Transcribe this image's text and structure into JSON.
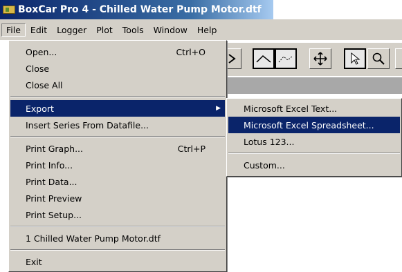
{
  "window": {
    "title": "BoxCar Pro 4 - Chilled Water Pump Motor.dtf"
  },
  "menubar": [
    "File",
    "Edit",
    "Logger",
    "Plot",
    "Tools",
    "Window",
    "Help"
  ],
  "file_menu": {
    "open": {
      "label": "Open...",
      "shortcut": "Ctrl+O"
    },
    "close": "Close",
    "close_all": "Close All",
    "export": "Export",
    "insert_series": "Insert Series From Datafile...",
    "print_graph": {
      "label": "Print Graph...",
      "shortcut": "Ctrl+P"
    },
    "print_info": "Print Info...",
    "print_data": "Print Data...",
    "print_preview": "Print Preview",
    "print_setup": "Print Setup...",
    "recent_file": "1 Chilled Water Pump Motor.dtf",
    "exit": "Exit"
  },
  "export_menu": {
    "excel_text": "Microsoft Excel Text...",
    "excel_spreadsheet": "Microsoft Excel Spreadsheet...",
    "lotus": "Lotus 123...",
    "custom": "Custom..."
  },
  "colors": {
    "highlight": "#0a246a",
    "face": "#d4d0c8",
    "title_start": "#0a246a"
  }
}
